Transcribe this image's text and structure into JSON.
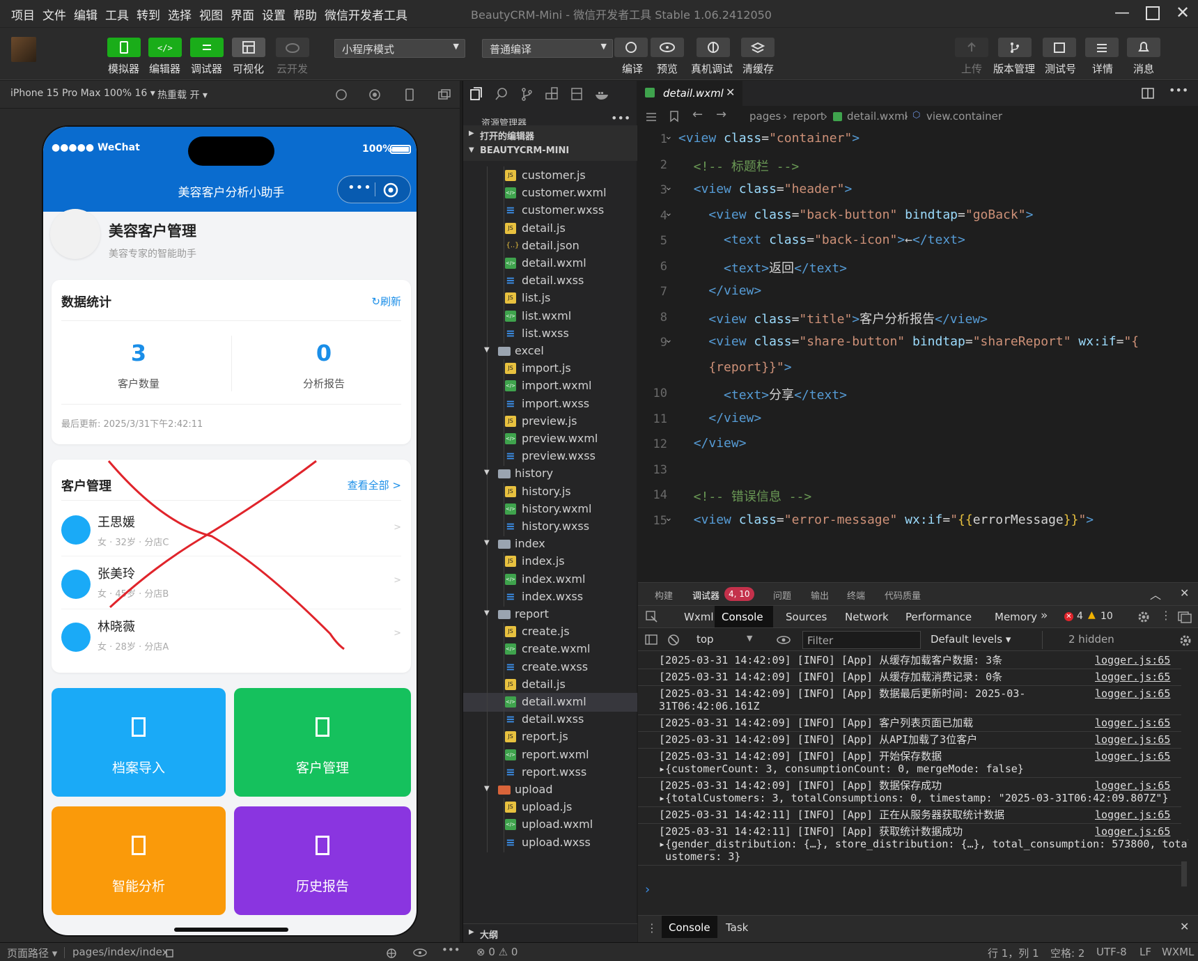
{
  "menu": [
    "项目",
    "文件",
    "编辑",
    "工具",
    "转到",
    "选择",
    "视图",
    "界面",
    "设置",
    "帮助",
    "微信开发者工具"
  ],
  "window_title": "BeautyCRM-Mini - 微信开发者工具 Stable 1.06.2412050",
  "toolbar": {
    "simulator": "模拟器",
    "editor": "编辑器",
    "debugger": "调试器",
    "visual": "可视化",
    "cloud": "云开发",
    "mode_select": "小程序模式",
    "compile_select": "普通编译",
    "compile": "编译",
    "preview": "预览",
    "real_debug": "真机调试",
    "clear_cache": "清缓存",
    "upload": "上传",
    "version": "版本管理",
    "test_account": "测试号",
    "details": "详情",
    "messages": "消息"
  },
  "simbar": {
    "device": "iPhone 15 Pro Max 100% 16 ▾",
    "hot_reload": "热重载 开 ▾"
  },
  "phone": {
    "carrier": "●●●●● WeChat",
    "battery": "100%",
    "nav_title": "美容客户分析小助手",
    "app_title": "美容客户管理",
    "app_subtitle": "美容专家的智能助手",
    "stats_title": "数据统计",
    "refresh": "↻刷新",
    "customer_count": "3",
    "customer_count_label": "客户数量",
    "report_count": "0",
    "report_count_label": "分析报告",
    "last_update": "最后更新: 2025/3/31下午2:42:11",
    "cm_title": "客户管理",
    "view_all": "查看全部 >",
    "customers": [
      {
        "name": "王思媛",
        "info": "女 · 32岁 · 分店C"
      },
      {
        "name": "张美玲",
        "info": "女 · 45岁 · 分店B"
      },
      {
        "name": "林晓薇",
        "info": "女 · 28岁 · 分店A"
      }
    ],
    "tiles": [
      {
        "label": "档案导入",
        "color": "#1aaaf7"
      },
      {
        "label": "客户管理",
        "color": "#15c15d"
      },
      {
        "label": "智能分析",
        "color": "#fa9a0a"
      },
      {
        "label": "历史报告",
        "color": "#8a35e0"
      }
    ]
  },
  "explorer": {
    "title": "资源管理器",
    "open_editors": "打开的编辑器",
    "project": "BEAUTYCRM-MINI",
    "outline": "大纲",
    "rows": [
      {
        "t": "customer.js",
        "k": "js",
        "d": 1
      },
      {
        "t": "customer.wxml",
        "k": "wxml",
        "d": 1
      },
      {
        "t": "customer.wxss",
        "k": "wxss",
        "d": 1
      },
      {
        "t": "detail.js",
        "k": "js",
        "d": 1
      },
      {
        "t": "detail.json",
        "k": "json",
        "d": 1
      },
      {
        "t": "detail.wxml",
        "k": "wxml",
        "d": 1
      },
      {
        "t": "detail.wxss",
        "k": "wxss",
        "d": 1
      },
      {
        "t": "list.js",
        "k": "js",
        "d": 1
      },
      {
        "t": "list.wxml",
        "k": "wxml",
        "d": 1
      },
      {
        "t": "list.wxss",
        "k": "wxss",
        "d": 1
      },
      {
        "t": "excel",
        "k": "folder",
        "d": 0
      },
      {
        "t": "import.js",
        "k": "js",
        "d": 1
      },
      {
        "t": "import.wxml",
        "k": "wxml",
        "d": 1
      },
      {
        "t": "import.wxss",
        "k": "wxss",
        "d": 1
      },
      {
        "t": "preview.js",
        "k": "js",
        "d": 1
      },
      {
        "t": "preview.wxml",
        "k": "wxml",
        "d": 1
      },
      {
        "t": "preview.wxss",
        "k": "wxss",
        "d": 1
      },
      {
        "t": "history",
        "k": "folder",
        "d": 0
      },
      {
        "t": "history.js",
        "k": "js",
        "d": 1
      },
      {
        "t": "history.wxml",
        "k": "wxml",
        "d": 1
      },
      {
        "t": "history.wxss",
        "k": "wxss",
        "d": 1
      },
      {
        "t": "index",
        "k": "folder",
        "d": 0
      },
      {
        "t": "index.js",
        "k": "js",
        "d": 1
      },
      {
        "t": "index.wxml",
        "k": "wxml",
        "d": 1
      },
      {
        "t": "index.wxss",
        "k": "wxss",
        "d": 1
      },
      {
        "t": "report",
        "k": "folder",
        "d": 0
      },
      {
        "t": "create.js",
        "k": "js",
        "d": 1
      },
      {
        "t": "create.wxml",
        "k": "wxml",
        "d": 1
      },
      {
        "t": "create.wxss",
        "k": "wxss",
        "d": 1
      },
      {
        "t": "detail.js",
        "k": "js",
        "d": 1
      },
      {
        "t": "detail.wxml",
        "k": "wxml",
        "d": 1,
        "sel": true
      },
      {
        "t": "detail.wxss",
        "k": "wxss",
        "d": 1
      },
      {
        "t": "report.js",
        "k": "js",
        "d": 1
      },
      {
        "t": "report.wxml",
        "k": "wxml",
        "d": 1
      },
      {
        "t": "report.wxss",
        "k": "wxss",
        "d": 1
      },
      {
        "t": "upload",
        "k": "folder",
        "d": 0
      },
      {
        "t": "upload.js",
        "k": "js",
        "d": 1
      },
      {
        "t": "upload.wxml",
        "k": "wxml",
        "d": 1
      },
      {
        "t": "upload.wxss",
        "k": "wxss",
        "d": 1
      }
    ]
  },
  "editor": {
    "tab": "detail.wxml",
    "breadcrumb": [
      "pages",
      "report",
      "detail.wxml",
      "view.container"
    ],
    "lines": [
      [
        [
          "tg",
          "<view "
        ],
        [
          "at",
          "class"
        ],
        [
          "tx2",
          "="
        ],
        [
          "st",
          "\"container\""
        ],
        [
          "tg",
          ">"
        ]
      ],
      [
        [
          "cm",
          "  <!-- 标题栏 -->"
        ]
      ],
      [
        [
          "tx2",
          "  "
        ],
        [
          "tg",
          "<view "
        ],
        [
          "at",
          "class"
        ],
        [
          "tx2",
          "="
        ],
        [
          "st",
          "\"header\""
        ],
        [
          "tg",
          ">"
        ]
      ],
      [
        [
          "tx2",
          "    "
        ],
        [
          "tg",
          "<view "
        ],
        [
          "at",
          "class"
        ],
        [
          "tx2",
          "="
        ],
        [
          "st",
          "\"back-button\""
        ],
        [
          "tx2",
          " "
        ],
        [
          "at",
          "bindtap"
        ],
        [
          "tx2",
          "="
        ],
        [
          "st",
          "\"goBack\""
        ],
        [
          "tg",
          ">"
        ]
      ],
      [
        [
          "tx2",
          "      "
        ],
        [
          "tg",
          "<text "
        ],
        [
          "at",
          "class"
        ],
        [
          "tx2",
          "="
        ],
        [
          "st",
          "\"back-icon\""
        ],
        [
          "tg",
          ">"
        ],
        [
          "tx2",
          "←"
        ],
        [
          "tg",
          "</text>"
        ]
      ],
      [
        [
          "tx2",
          "      "
        ],
        [
          "tg",
          "<text>"
        ],
        [
          "tx2",
          "返回"
        ],
        [
          "tg",
          "</text>"
        ]
      ],
      [
        [
          "tx2",
          "    "
        ],
        [
          "tg",
          "</view>"
        ]
      ],
      [
        [
          "tx2",
          "    "
        ],
        [
          "tg",
          "<view "
        ],
        [
          "at",
          "class"
        ],
        [
          "tx2",
          "="
        ],
        [
          "st",
          "\"title\""
        ],
        [
          "tg",
          ">"
        ],
        [
          "tx2",
          "客户分析报告"
        ],
        [
          "tg",
          "</view>"
        ]
      ],
      [
        [
          "tx2",
          "    "
        ],
        [
          "tg",
          "<view "
        ],
        [
          "at",
          "class"
        ],
        [
          "tx2",
          "="
        ],
        [
          "st",
          "\"share-button\""
        ],
        [
          "tx2",
          " "
        ],
        [
          "at",
          "bindtap"
        ],
        [
          "tx2",
          "="
        ],
        [
          "st",
          "\"shareReport\""
        ],
        [
          "tx2",
          " "
        ],
        [
          "at",
          "wx:if"
        ],
        [
          "tx2",
          "="
        ],
        [
          "st",
          "\"{"
        ]
      ],
      [
        [
          "st",
          "    {report}}\""
        ],
        [
          "tg",
          ">"
        ]
      ],
      [
        [
          "tx2",
          "      "
        ],
        [
          "tg",
          "<text>"
        ],
        [
          "tx2",
          "分享"
        ],
        [
          "tg",
          "</text>"
        ]
      ],
      [
        [
          "tx2",
          "    "
        ],
        [
          "tg",
          "</view>"
        ]
      ],
      [
        [
          "tx2",
          "  "
        ],
        [
          "tg",
          "</view>"
        ]
      ],
      [
        [
          "tx2",
          ""
        ]
      ],
      [
        [
          "cm",
          "  <!-- 错误信息 -->"
        ]
      ],
      [
        [
          "tx2",
          "  "
        ],
        [
          "tg",
          "<view "
        ],
        [
          "at",
          "class"
        ],
        [
          "tx2",
          "="
        ],
        [
          "st",
          "\"error-message\""
        ],
        [
          "tx2",
          " "
        ],
        [
          "at",
          "wx:if"
        ],
        [
          "tx2",
          "="
        ],
        [
          "st",
          "\""
        ],
        [
          "br",
          "{{"
        ],
        [
          "tx2",
          "errorMessage"
        ],
        [
          "br",
          "}}"
        ],
        [
          "st",
          "\""
        ],
        [
          "tg",
          ">"
        ]
      ]
    ],
    "line_numbers": [
      "1",
      "2",
      "3",
      "4",
      "5",
      "6",
      "7",
      "8",
      "9",
      "",
      "10",
      "11",
      "12",
      "13",
      "14",
      "15"
    ]
  },
  "devtools": {
    "tabs": [
      "构建",
      "调试器",
      "问题",
      "输出",
      "终端",
      "代码质量"
    ],
    "badge": "4, 10",
    "subtabs": [
      "Wxml",
      "Console",
      "Sources",
      "Network",
      "Performance",
      "Memory"
    ],
    "errors": "4",
    "warnings": "10",
    "context": "top",
    "filter": "Filter",
    "levels": "Default levels ▾",
    "hidden": "2 hidden",
    "logs": [
      {
        "text": "[2025-03-31 14:42:09] [INFO] [App] 从缓存加载客户数据: 3条",
        "src": "logger.js:65"
      },
      {
        "text": "[2025-03-31 14:42:09] [INFO] [App] 从缓存加载消费记录: 0条",
        "src": "logger.js:65"
      },
      {
        "text": "[2025-03-31 14:42:09] [INFO] [App] 数据最后更新时间: 2025-03-\n31T06:42:06.161Z",
        "src": "logger.js:65"
      },
      {
        "text": "[2025-03-31 14:42:09] [INFO] [App] 客户列表页面已加载",
        "src": "logger.js:65"
      },
      {
        "text": "[2025-03-31 14:42:09] [INFO] [App] 从API加载了3位客户",
        "src": "logger.js:65"
      },
      {
        "text": "[2025-03-31 14:42:09] [INFO] [App] 开始保存数据\n▸{customerCount: 3, consumptionCount: 0, mergeMode: false}",
        "src": "logger.js:65"
      },
      {
        "text": "[2025-03-31 14:42:09] [INFO] [App] 数据保存成功\n▸{totalCustomers: 3, totalConsumptions: 0, timestamp: \"2025-03-31T06:42:09.807Z\"}",
        "src": "logger.js:65"
      },
      {
        "text": "[2025-03-31 14:42:11] [INFO] [App] 正在从服务器获取统计数据",
        "src": "logger.js:65"
      },
      {
        "text": "[2025-03-31 14:42:11] [INFO] [App] 获取统计数据成功\n▸{gender_distribution: {…}, store_distribution: {…}, total_consumption: 573800, total_c\n ustomers: 3}",
        "src": "logger.js:65"
      }
    ],
    "prompt": "›",
    "drawer_tabs": [
      "Console",
      "Task"
    ]
  },
  "status": {
    "page_path_label": "页面路径 ▾",
    "page_path": "pages/index/index",
    "errors": "⊗ 0 ⚠ 0",
    "cursor": "行 1，列 1",
    "spaces": "空格: 2",
    "encoding": "UTF-8",
    "eol": "LF",
    "lang": "WXML"
  }
}
